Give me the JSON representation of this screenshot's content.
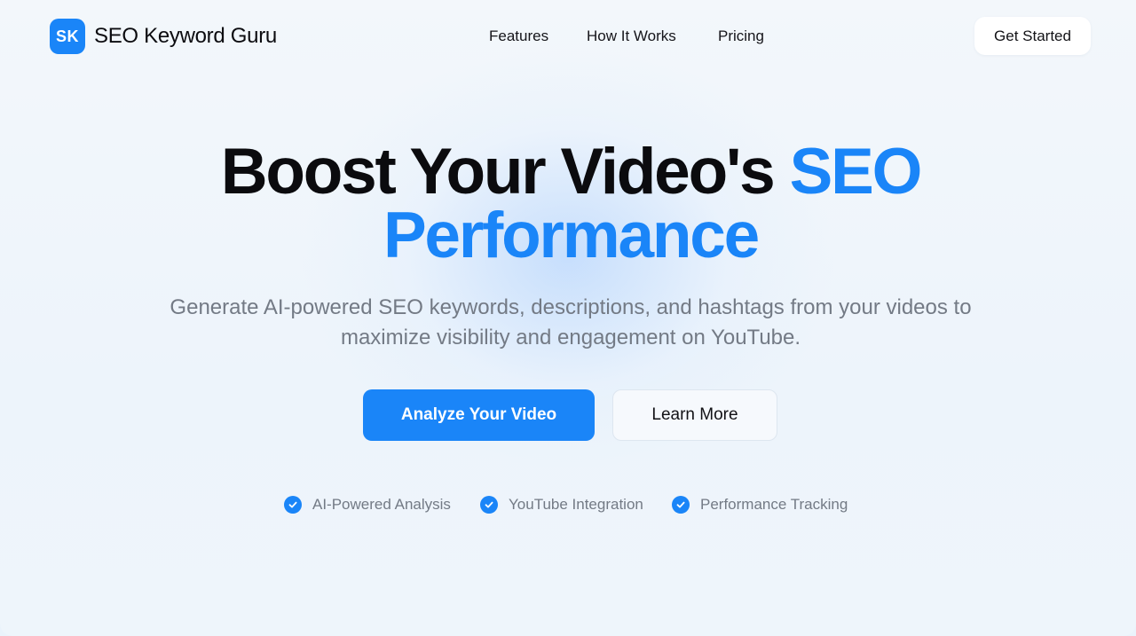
{
  "header": {
    "logo_initials": "SK",
    "logo_text": "SEO Keyword Guru",
    "nav": [
      "Features",
      "How It Works",
      "Pricing"
    ],
    "cta_label": "Get Started"
  },
  "hero": {
    "title_part1": "Boost Your Video's ",
    "title_accent1": "SEO",
    "title_line2": "Performance",
    "subtitle": "Generate AI-powered SEO keywords, descriptions, and hashtags from your videos to maximize visibility and engagement on YouTube.",
    "primary_button": "Analyze Your Video",
    "secondary_button": "Learn More"
  },
  "features": [
    {
      "label": "AI-Powered Analysis",
      "icon": "check-circle-icon"
    },
    {
      "label": "YouTube Integration",
      "icon": "check-circle-icon"
    },
    {
      "label": "Performance Tracking",
      "icon": "check-circle-icon"
    }
  ],
  "colors": {
    "accent": "#1a85f8",
    "text": "#0b0b0e",
    "muted": "#737a85",
    "background": "#eef5fb"
  }
}
